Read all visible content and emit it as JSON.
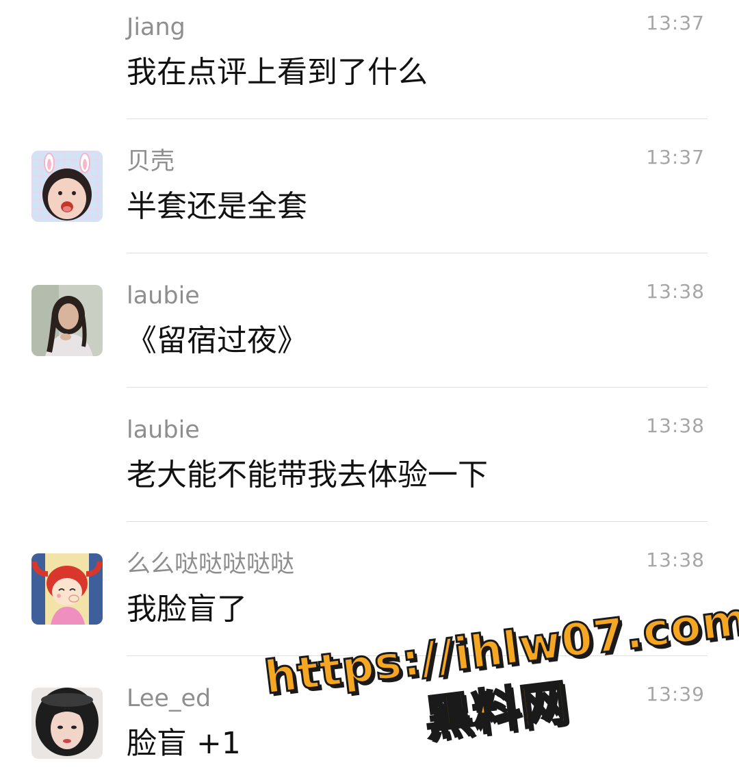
{
  "messages": [
    {
      "name": "Jiang",
      "time": "13:37",
      "text": "我在点评上看到了什么",
      "avatar": "none"
    },
    {
      "name": "贝壳",
      "time": "13:37",
      "text": "半套还是全套",
      "avatar": "child-bunny-ears-photo"
    },
    {
      "name": "laubie",
      "time": "13:38",
      "text": "《留宿过夜》",
      "avatar": "woman-portrait-photo"
    },
    {
      "name": "laubie",
      "time": "13:38",
      "text": "老大能不能带我去体验一下",
      "avatar": "none"
    },
    {
      "name": "么么哒哒哒哒哒",
      "time": "13:38",
      "text": "我脸盲了",
      "avatar": "cartoon-girl-red-pigtails"
    },
    {
      "name": "Lee_ed",
      "time": "13:39",
      "text": "脸盲 +1",
      "avatar": "woman-helmet-photo"
    }
  ],
  "watermark": {
    "url": "https://ihlw07.com",
    "label": "黑料网",
    "color": "#f5a623"
  }
}
